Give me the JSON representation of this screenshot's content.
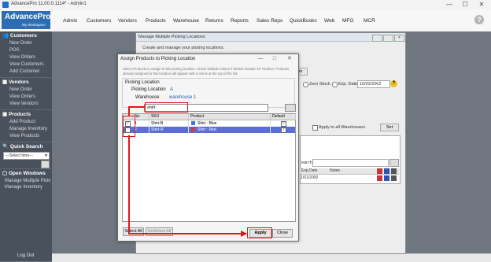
{
  "window": {
    "title": "AdvancePro 11.00.0.1114* - Admin1",
    "minimize": "—",
    "maximize": "☐",
    "close": "✕"
  },
  "logo": {
    "name": "AdvancePro",
    "tagline": "My Workspace"
  },
  "menu": [
    "Admin",
    "Customers",
    "Vendors",
    "Products",
    "Warehouse",
    "Returns",
    "Reports",
    "Sales Reps",
    "QuickBooks",
    "Web",
    "MFG",
    "MCR"
  ],
  "help_label": "?",
  "sidebar": {
    "customers": {
      "title": "Customers",
      "items": [
        "New Order",
        "POS",
        "View Orders",
        "View Customers",
        "Add Customer"
      ]
    },
    "vendors": {
      "title": "Vendors",
      "items": [
        "New Order",
        "View Orders",
        "View Vendors"
      ]
    },
    "products": {
      "title": "Products",
      "items": [
        "Add Product",
        "Manage Inventory",
        "View Products"
      ]
    },
    "quick_search": {
      "title": "Quick Search",
      "select_value": "---Select Item---"
    },
    "open_windows": {
      "title": "Open Windows",
      "items": [
        "Manage Multiple Picki",
        "Manage Inventory"
      ]
    },
    "logout": "Log Out"
  },
  "background_window": {
    "title": "Manage Multiple Picking Locations",
    "subtitle": "Create and manage your picking locations.",
    "zero_stock": "Zero Stock",
    "exp_date_label": "Exp. Date",
    "exp_date_value": "10/02/2002",
    "apply_all_warehouses": "Apply to all Warehouses",
    "set_button": "Set",
    "search_label": "earch",
    "col_exp_date": "Exp.Date",
    "col_notes": "Notes",
    "row_date": "1/01/2000",
    "partial_button": "er"
  },
  "dialog": {
    "title": "Assign Products to Picking Location",
    "description": "Select Products to assign to this picking location. Check Default column if default location for Product. Products already assigned to this location will appear with a check at the top of the list.",
    "group_title": "Picking Location",
    "picking_location_label": "Picking Location",
    "picking_location_value": "A",
    "warehouse_label": "Warehouse",
    "warehouse_value": "warehouse 1",
    "filter_value": "shirt",
    "columns": [
      "",
      "No",
      "SKU",
      "Product",
      "Default"
    ],
    "rows": [
      {
        "checked": true,
        "no": "1",
        "sku": "Shirt-B",
        "product": "Shirt : Blue",
        "default": true
      },
      {
        "checked": false,
        "no": "2",
        "sku": "Shirt-R",
        "product": "Shirt : Red",
        "default": true
      }
    ],
    "select_all": "Select All",
    "deselect_all": "DeSelect All",
    "apply": "Apply",
    "close": "Close"
  },
  "colors": {
    "accent": "#2f6db3",
    "sidebar": "#49515c",
    "selected_row": "#5b6ed6",
    "annotation": "#e01818"
  }
}
